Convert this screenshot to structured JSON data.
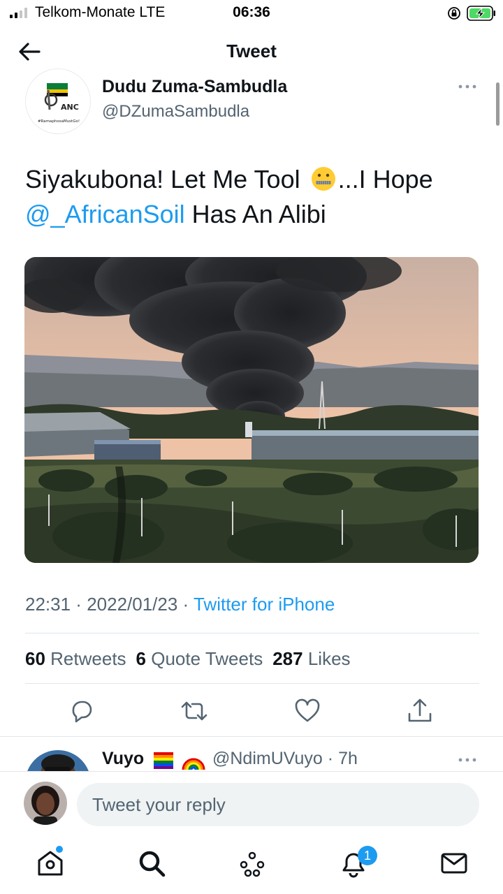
{
  "status_bar": {
    "carrier": "Telkom-Monate  LTE",
    "time": "06:36",
    "icons": [
      "signal-icon",
      "orientation-lock-icon",
      "battery-charging-icon"
    ]
  },
  "header": {
    "title": "Tweet",
    "back_icon": "arrow-left-icon"
  },
  "tweet": {
    "author": {
      "name": "Dudu Zuma-Sambudla",
      "handle": "@DZumaSambudla",
      "avatar_text": "ANC",
      "avatar_caption": "#RamaphosaMustGo!"
    },
    "text_part1": "Siyakubona! Let Me Tool ",
    "text_part2": "...I Hope",
    "mention": "@_AfricanSoil",
    "text_part3": " Has An Alibi",
    "emoji": "zipper-mouth-face",
    "time": "22:31",
    "date": "2022/01/23",
    "source": "Twitter for iPhone",
    "stats": {
      "retweets_count": "60",
      "retweets_label": "Retweets",
      "quotes_count": "6",
      "quotes_label": "Quote Tweets",
      "likes_count": "287",
      "likes_label": "Likes"
    },
    "actions": [
      "reply-icon",
      "retweet-icon",
      "like-icon",
      "share-icon"
    ]
  },
  "reply_preview": {
    "name": "Vuyo",
    "handle": "@NdimUVuyo",
    "time_ago": "7h",
    "separator": "·"
  },
  "composer": {
    "placeholder": "Tweet your reply"
  },
  "tabbar": {
    "tabs": [
      "home-icon",
      "search-icon",
      "spaces-icon",
      "notifications-icon",
      "messages-icon"
    ],
    "notification_badge": "1"
  },
  "colors": {
    "accent": "#1d9bf0",
    "text": "#0f1419",
    "secondary": "#536471"
  }
}
